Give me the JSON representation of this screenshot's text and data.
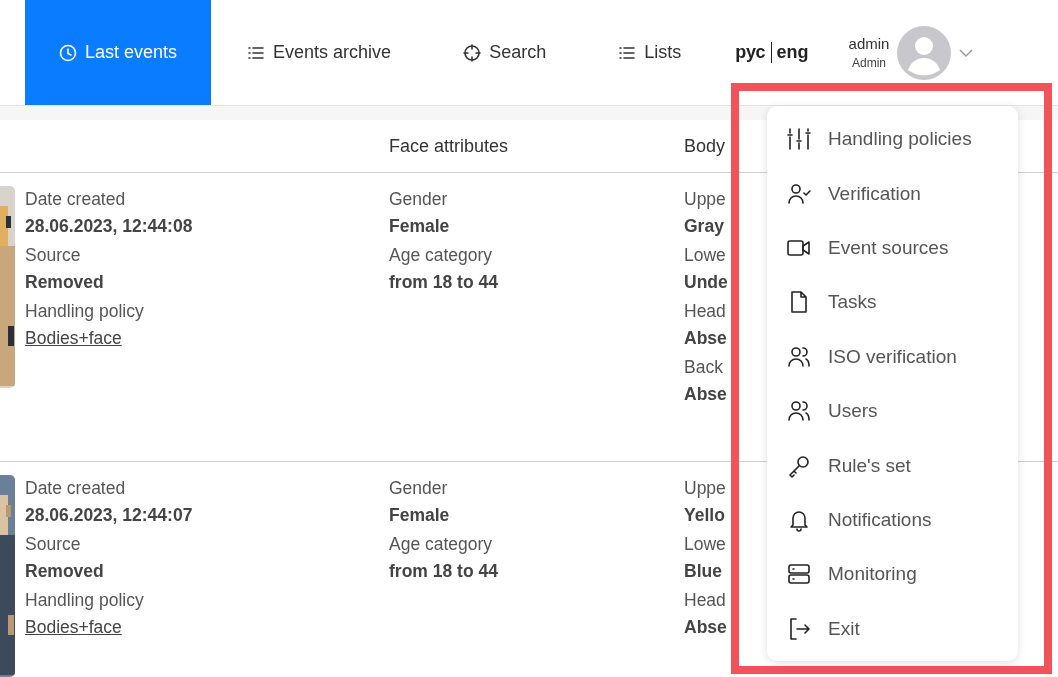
{
  "nav": {
    "tabs": [
      {
        "label": "Last events",
        "selected": true
      },
      {
        "label": "Events archive",
        "selected": false
      },
      {
        "label": "Search",
        "selected": false
      },
      {
        "label": "Lists",
        "selected": false
      }
    ],
    "languages": [
      "рус",
      "eng"
    ],
    "user": {
      "name": "admin",
      "role": "Admin"
    }
  },
  "events": {
    "columns": [
      "Face attributes",
      "Body"
    ],
    "rows": [
      {
        "details": [
          {
            "label": "Date created",
            "value": "28.06.2023, 12:44:08"
          },
          {
            "label": "Source",
            "value": "Removed"
          },
          {
            "label": "Handling policy",
            "value": "Bodies+face",
            "kind": "link"
          }
        ],
        "face": [
          {
            "label": "Gender",
            "value": "Female"
          },
          {
            "label": "Age category",
            "value": "from 18 to 44"
          }
        ],
        "body": [
          {
            "label": "Uppe",
            "value": "Gray"
          },
          {
            "label": "Lowe",
            "value": "Unde"
          },
          {
            "label": "Head",
            "value": "Abse"
          },
          {
            "label": "Back",
            "value": "Abse"
          }
        ]
      },
      {
        "details": [
          {
            "label": "Date created",
            "value": "28.06.2023, 12:44:07"
          },
          {
            "label": "Source",
            "value": "Removed"
          },
          {
            "label": "Handling policy",
            "value": "Bodies+face",
            "kind": "link"
          }
        ],
        "face": [
          {
            "label": "Gender",
            "value": "Female"
          },
          {
            "label": "Age category",
            "value": "from 18 to 44"
          }
        ],
        "body": [
          {
            "label": "Uppe",
            "value": "Yello"
          },
          {
            "label": "Lowe",
            "value": "Blue"
          },
          {
            "label": "Head",
            "value": "Abse"
          }
        ]
      }
    ]
  },
  "user_menu": {
    "items": [
      "Handling policies",
      "Verification",
      "Event sources",
      "Tasks",
      "ISO verification",
      "Users",
      "Rule's set",
      "Notifications",
      "Monitoring",
      "Exit"
    ]
  }
}
